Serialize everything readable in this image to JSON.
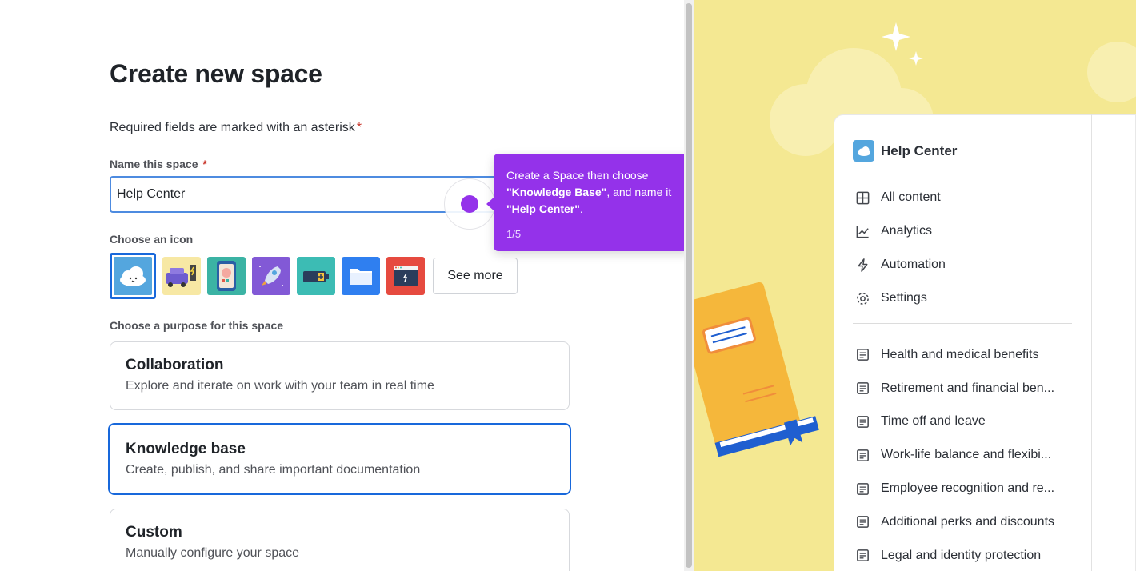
{
  "form": {
    "title": "Create new space",
    "required_note": "Required fields are marked with an asterisk",
    "asterisk": "*",
    "name_label": "Name this space",
    "name_value": "Help Center",
    "icon_label": "Choose an icon",
    "icons": [
      "cloud-icon",
      "car-charging-icon",
      "phone-avatar-icon",
      "rocket-icon",
      "battery-icon",
      "folder-icon",
      "browser-window-icon"
    ],
    "see_more": "See more",
    "purpose_label": "Choose a purpose for this space",
    "purposes": [
      {
        "title": "Collaboration",
        "desc": "Explore and iterate on work with your team in real time"
      },
      {
        "title": "Knowledge base",
        "desc": "Create, publish, and share important documentation"
      },
      {
        "title": "Custom",
        "desc": "Manually configure your space"
      }
    ]
  },
  "tooltip": {
    "line1": "Create a Space then choose",
    "bold1": "\"Knowledge Base\"",
    "mid": ", and name it ",
    "bold2": "\"Help Center\"",
    "end": ".",
    "step": "1/5",
    "color": "#9432ea"
  },
  "preview": {
    "space_name": "Help Center",
    "nav": [
      {
        "icon": "grid-icon",
        "label": "All content"
      },
      {
        "icon": "chart-icon",
        "label": "Analytics"
      },
      {
        "icon": "lightning-icon",
        "label": "Automation"
      },
      {
        "icon": "gear-icon",
        "label": "Settings"
      }
    ],
    "pages": [
      "Health and medical benefits",
      "Retirement and financial ben...",
      "Time off and leave",
      "Work-life balance and flexibi...",
      "Employee recognition and re...",
      "Additional perks and discounts",
      "Legal and identity protection"
    ],
    "background_color": "#f4e892"
  },
  "colors": {
    "accent": "#1868db",
    "required": "#c9372c"
  }
}
